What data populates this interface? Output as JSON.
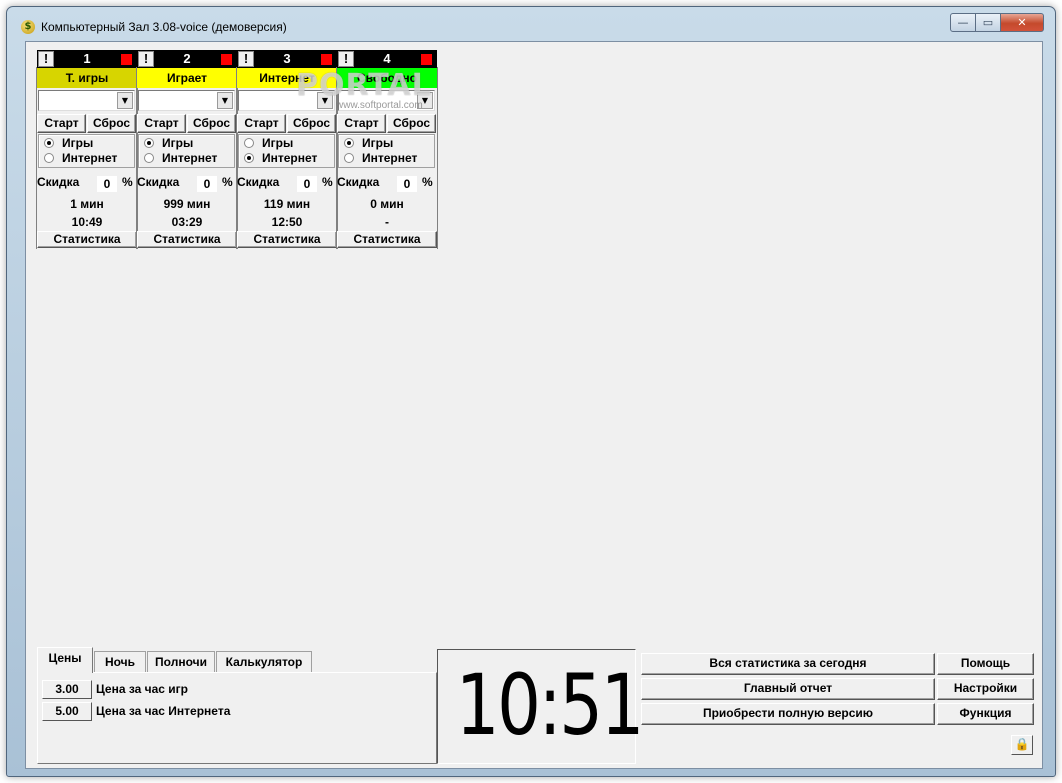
{
  "window": {
    "title": "Компьютерный Зал 3.08-voice (демоверсия)",
    "app_icon": "$",
    "minimize_icon": "—",
    "maximize_icon": "▭",
    "close_icon": "✕"
  },
  "watermark": {
    "text": "PORTAL",
    "sub": "www.softportal.com"
  },
  "computers": [
    {
      "number": "1",
      "alert": "!",
      "status": "Т. игры",
      "status_color": "#d7d500",
      "start_label": "Старт",
      "reset_label": "Сброс",
      "radio_games": "Игры",
      "radio_internet": "Интернет",
      "mode": "games",
      "discount_label": "Скидка",
      "discount_value": "0",
      "percent": "%",
      "minutes": "1 мин",
      "time": "10:49",
      "stats_label": "Статистика"
    },
    {
      "number": "2",
      "alert": "!",
      "status": "Играет",
      "status_color": "#ffff00",
      "start_label": "Старт",
      "reset_label": "Сброс",
      "radio_games": "Игры",
      "radio_internet": "Интернет",
      "mode": "games",
      "discount_label": "Скидка",
      "discount_value": "0",
      "percent": "%",
      "minutes": "999 мин",
      "time": "03:29",
      "stats_label": "Статистика"
    },
    {
      "number": "3",
      "alert": "!",
      "status": "Интернет",
      "status_color": "#ffff00",
      "start_label": "Старт",
      "reset_label": "Сброс",
      "radio_games": "Игры",
      "radio_internet": "Интернет",
      "mode": "internet",
      "discount_label": "Скидка",
      "discount_value": "0",
      "percent": "%",
      "minutes": "119 мин",
      "time": "12:50",
      "stats_label": "Статистика"
    },
    {
      "number": "4",
      "alert": "!",
      "status": "Свободно",
      "status_color": "#00ff00",
      "start_label": "Старт",
      "reset_label": "Сброс",
      "radio_games": "Игры",
      "radio_internet": "Интернет",
      "mode": "games",
      "discount_label": "Скидка",
      "discount_value": "0",
      "percent": "%",
      "minutes": "0 мин",
      "time": "-",
      "stats_label": "Статистика"
    }
  ],
  "tabs": {
    "items": [
      "Цены",
      "Ночь",
      "Полночи",
      "Калькулятор"
    ],
    "active": "Цены"
  },
  "prices": [
    {
      "value": "3.00",
      "label": "Цена за час игр"
    },
    {
      "value": "5.00",
      "label": "Цена за час Интернета"
    }
  ],
  "clock": "10:51",
  "actions": {
    "all_stats": "Вся статистика за сегодня",
    "main_report": "Главный отчет",
    "buy_full": "Приобрести полную версию",
    "help": "Помощь",
    "settings": "Настройки",
    "function": "Функция",
    "lock_icon": "🔒"
  }
}
